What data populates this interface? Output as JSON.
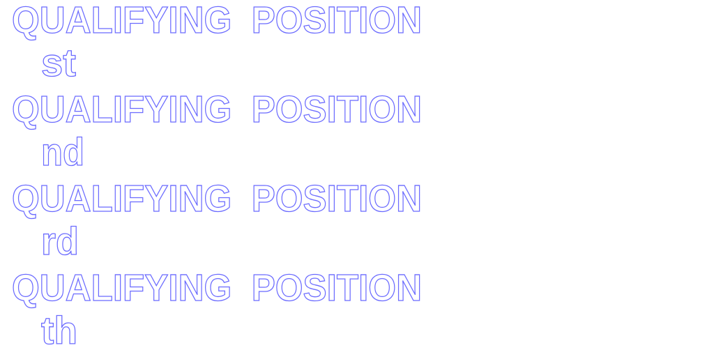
{
  "stroke_color": "#6b6bff",
  "entries": [
    {
      "label": "QUALIFYING  POSITION",
      "suffix": "st"
    },
    {
      "label": "QUALIFYING  POSITION",
      "suffix": "nd"
    },
    {
      "label": "QUALIFYING  POSITION",
      "suffix": "rd"
    },
    {
      "label": "QUALIFYING  POSITION",
      "suffix": "th"
    }
  ]
}
